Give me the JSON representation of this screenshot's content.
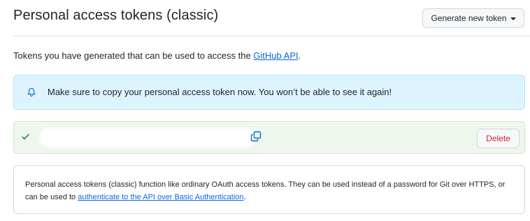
{
  "header": {
    "title": "Personal access tokens (classic)",
    "generate_button_label": "Generate new token"
  },
  "intro": {
    "text_before_link": "Tokens you have generated that can be used to access the ",
    "link_text": "GitHub API",
    "text_after_link": "."
  },
  "flash": {
    "icon": "bell-icon",
    "message": "Make sure to copy your personal access token now. You won’t be able to see it again!"
  },
  "token": {
    "status_icon": "check-icon",
    "value": "",
    "copy_icon": "copy-icon",
    "delete_label": "Delete"
  },
  "info": {
    "text_before_link": "Personal access tokens (classic) function like ordinary OAuth access tokens. They can be used instead of a password for Git over HTTPS, or can be used to ",
    "link_text": "authenticate to the API over Basic Authentication",
    "text_after_link": "."
  },
  "colors": {
    "link": "#0969da",
    "flash_background": "#ddf4ff",
    "token_row_background": "#eef7ec",
    "success_check": "#1a7f37",
    "danger": "#cf222e"
  }
}
